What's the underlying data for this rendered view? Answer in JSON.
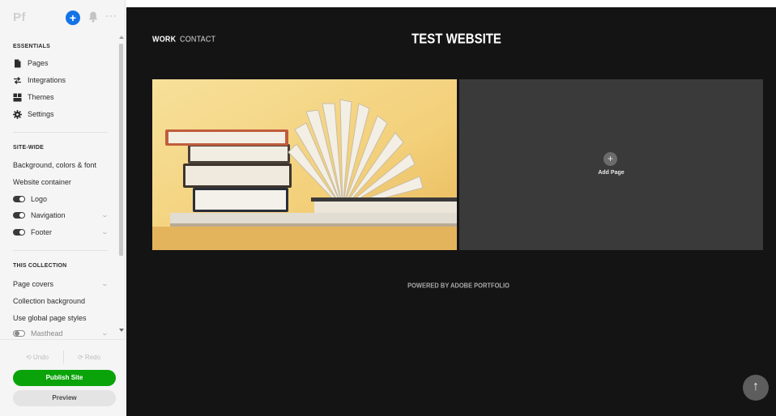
{
  "app": {
    "logo": "Pf",
    "add_symbol": "+",
    "more_symbol": "···",
    "icons": {
      "add": "plus-circle-icon",
      "notifications": "bell-icon",
      "more": "more-horizontal-icon"
    },
    "accent_color": "#1473e6"
  },
  "sidebar": {
    "essentials": {
      "title": "ESSENTIALS",
      "items": [
        {
          "label": "Pages",
          "icon": "page-icon"
        },
        {
          "label": "Integrations",
          "icon": "integrations-icon"
        },
        {
          "label": "Themes",
          "icon": "themes-icon"
        },
        {
          "label": "Settings",
          "icon": "gear-icon"
        }
      ]
    },
    "site_wide": {
      "title": "SITE-WIDE",
      "items": [
        {
          "label": "Background, colors & font"
        },
        {
          "label": "Website container"
        },
        {
          "label": "Logo",
          "toggle": "on"
        },
        {
          "label": "Navigation",
          "toggle": "on",
          "expandable": true
        },
        {
          "label": "Footer",
          "toggle": "on",
          "expandable": true
        }
      ]
    },
    "collection": {
      "title": "THIS COLLECTION",
      "items": [
        {
          "label": "Page covers",
          "expandable": true
        },
        {
          "label": "Collection background"
        },
        {
          "label": "Use global page styles"
        },
        {
          "label": "Masthead",
          "toggle": "off",
          "expandable": true
        }
      ]
    },
    "chevron": "⌄",
    "actions": {
      "undo": "⟲ Undo",
      "redo": "⟳ Redo",
      "publish": "Publish Site",
      "preview": "Preview",
      "publish_color": "#0aa30a"
    }
  },
  "site": {
    "nav": {
      "work": "WORK",
      "contact": "CONTACT"
    },
    "title": "TEST WEBSITE",
    "add_page": {
      "symbol": "+",
      "label": "Add Page"
    },
    "footer": "POWERED BY ADOBE PORTFOLIO",
    "back_to_top": "↑",
    "background_color": "#141414"
  }
}
